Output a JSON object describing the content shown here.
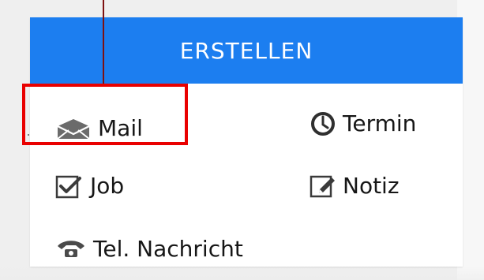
{
  "menu": {
    "title": "ERSTELLEN",
    "items": [
      {
        "label": "Mail",
        "icon": "mail-icon"
      },
      {
        "label": "Termin",
        "icon": "clock-icon"
      },
      {
        "label": "Job",
        "icon": "checkbox-icon"
      },
      {
        "label": "Notiz",
        "icon": "note-edit-icon"
      },
      {
        "label": "Tel. Nachricht",
        "icon": "phone-icon"
      }
    ]
  },
  "colors": {
    "header_blue": "#1c7ef0",
    "highlight_red": "#e90000",
    "pointer_red": "#7d1111"
  }
}
